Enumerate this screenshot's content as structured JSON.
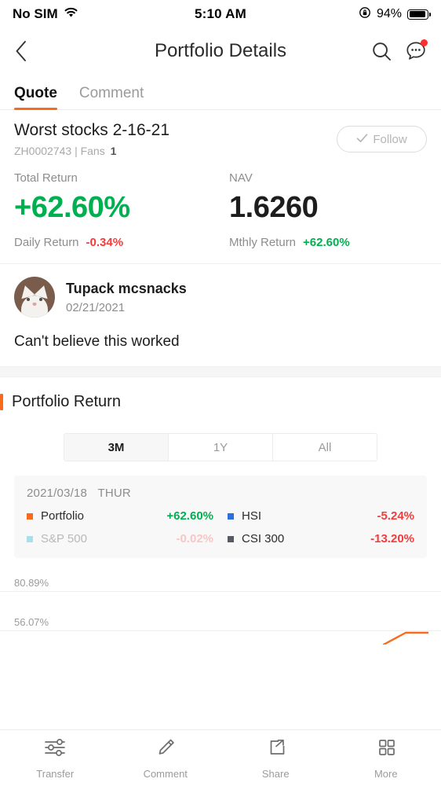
{
  "status_bar": {
    "carrier": "No SIM",
    "wifi_icon": "wifi-icon",
    "time": "5:10 AM",
    "rotation_lock_icon": "rotation-lock-icon",
    "battery_percent": "94%",
    "battery_icon": "battery-icon"
  },
  "nav": {
    "back_icon": "back-chevron-icon",
    "title": "Portfolio Details",
    "search_icon": "search-icon",
    "chat_icon": "chat-bubble-icon",
    "has_notification": true
  },
  "tabs": [
    {
      "label": "Quote",
      "active": true
    },
    {
      "label": "Comment",
      "active": false
    }
  ],
  "portfolio": {
    "name": "Worst stocks 2-16-21",
    "code": "ZH0002743",
    "separator": "|",
    "fans_label": "Fans",
    "fans_count": "1",
    "follow_label": "Follow",
    "follow_icon": "check-icon"
  },
  "stats": {
    "total_return_label": "Total Return",
    "total_return_value": "+62.60%",
    "nav_label": "NAV",
    "nav_value": "1.6260",
    "daily_return_label": "Daily Return",
    "daily_return_value": "-0.34%",
    "mthly_return_label": "Mthly Return",
    "mthly_return_value": "+62.60%"
  },
  "comment": {
    "author": "Tupack mcsnacks",
    "date": "02/21/2021",
    "text": "Can't believe this worked",
    "avatar_icon": "cat-avatar"
  },
  "section": {
    "title": "Portfolio Return",
    "ranges": [
      {
        "label": "3M",
        "active": true
      },
      {
        "label": "1Y",
        "active": false
      },
      {
        "label": "All",
        "active": false
      }
    ]
  },
  "colors": {
    "accent_orange": "#f96a1b",
    "green": "#00b050",
    "red": "#f63b3b",
    "portfolio": "#f96a1b",
    "hsi": "#2d6fe0",
    "sp500": "#a8e0ea",
    "csi300": "#555b63"
  },
  "chart_data": {
    "type": "line",
    "title": "Portfolio Return",
    "date": "2021/03/18",
    "day_of_week": "THUR",
    "xlabel": "",
    "ylabel": "",
    "grid": true,
    "ytick_labels": [
      "80.89%",
      "56.07%"
    ],
    "ytick_values": [
      80.89,
      56.07
    ],
    "legend_position": "top",
    "series": [
      {
        "name": "Portfolio",
        "value": "+62.60%",
        "color": "#f96a1b",
        "muted": false
      },
      {
        "name": "HSI",
        "value": "-5.24%",
        "color": "#2d6fe0",
        "muted": false
      },
      {
        "name": "S&P 500",
        "value": "-0.02%",
        "color": "#a8e0ea",
        "muted": true
      },
      {
        "name": "CSI 300",
        "value": "-13.20%",
        "color": "#555b63",
        "muted": false
      }
    ]
  },
  "bottom_bar": [
    {
      "label": "Transfer",
      "icon": "sliders-icon"
    },
    {
      "label": "Comment",
      "icon": "pencil-icon"
    },
    {
      "label": "Share",
      "icon": "share-box-icon"
    },
    {
      "label": "More",
      "icon": "grid-icon"
    }
  ]
}
